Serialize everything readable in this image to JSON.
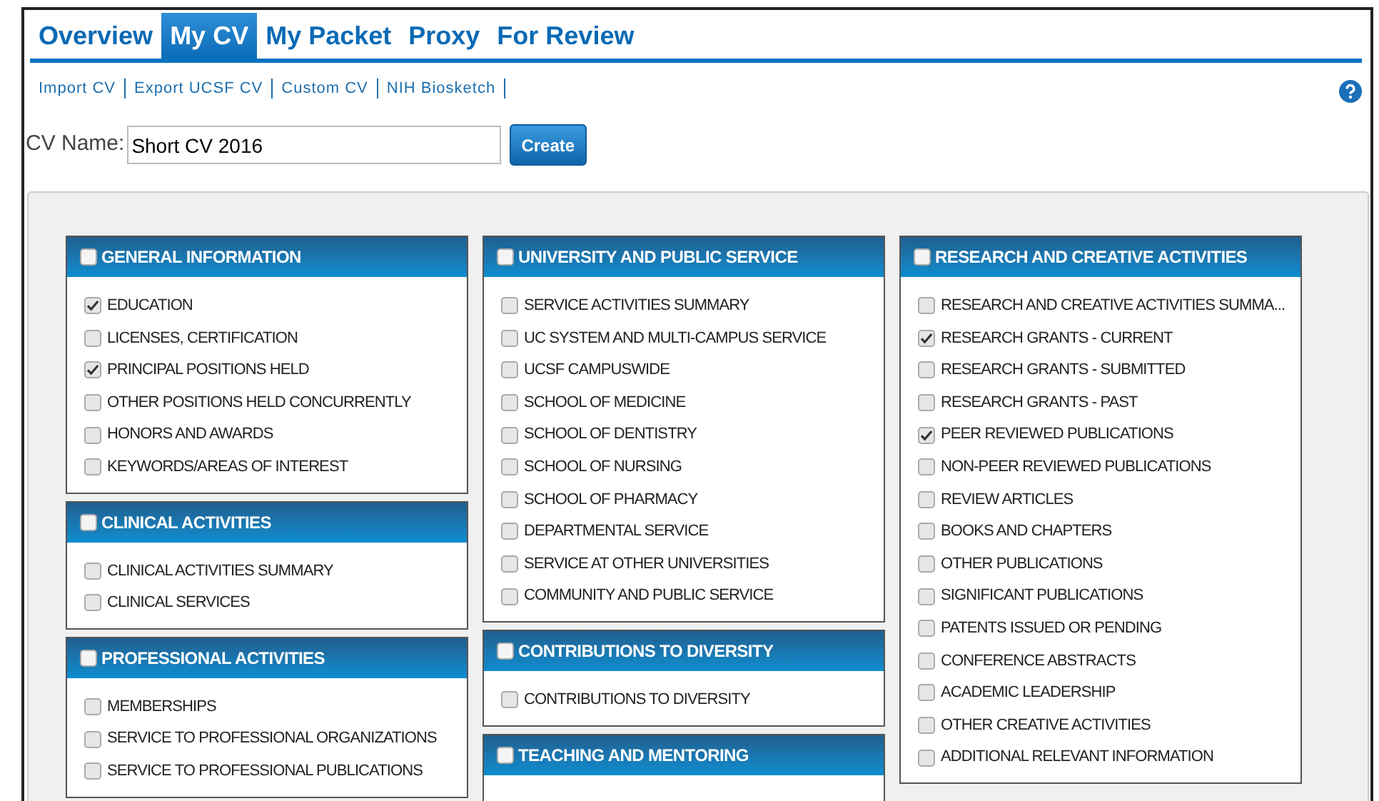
{
  "tabs": [
    {
      "label": "Overview",
      "selected": false
    },
    {
      "label": "My CV",
      "selected": true
    },
    {
      "label": "My Packet",
      "selected": false
    },
    {
      "label": "Proxy",
      "selected": false
    },
    {
      "label": "For Review",
      "selected": false
    }
  ],
  "sub_links": [
    "Import CV",
    "Export UCSF CV",
    "Custom CV",
    "NIH Biosketch"
  ],
  "cv_name": {
    "label": "CV Name:",
    "value": "Short CV 2016"
  },
  "create_button": "Create",
  "columns": [
    [
      {
        "title": "GENERAL INFORMATION",
        "checked": false,
        "items": [
          {
            "label": "EDUCATION",
            "checked": true
          },
          {
            "label": "LICENSES, CERTIFICATION",
            "checked": false
          },
          {
            "label": "PRINCIPAL POSITIONS HELD",
            "checked": true
          },
          {
            "label": "OTHER POSITIONS HELD CONCURRENTLY",
            "checked": false
          },
          {
            "label": "HONORS AND AWARDS",
            "checked": false
          },
          {
            "label": "KEYWORDS/AREAS OF INTEREST",
            "checked": false
          }
        ]
      },
      {
        "title": "CLINICAL ACTIVITIES",
        "checked": false,
        "items": [
          {
            "label": "CLINICAL ACTIVITIES SUMMARY",
            "checked": false
          },
          {
            "label": "CLINICAL SERVICES",
            "checked": false
          }
        ]
      },
      {
        "title": "PROFESSIONAL ACTIVITIES",
        "checked": false,
        "items": [
          {
            "label": "MEMBERSHIPS",
            "checked": false
          },
          {
            "label": "SERVICE TO PROFESSIONAL ORGANIZATIONS",
            "checked": false
          },
          {
            "label": "SERVICE TO PROFESSIONAL PUBLICATIONS",
            "checked": false
          }
        ]
      }
    ],
    [
      {
        "title": "UNIVERSITY AND PUBLIC SERVICE",
        "checked": false,
        "items": [
          {
            "label": "SERVICE ACTIVITIES SUMMARY",
            "checked": false
          },
          {
            "label": "UC SYSTEM AND MULTI-CAMPUS SERVICE",
            "checked": false
          },
          {
            "label": "UCSF CAMPUSWIDE",
            "checked": false
          },
          {
            "label": "SCHOOL OF MEDICINE",
            "checked": false
          },
          {
            "label": "SCHOOL OF DENTISTRY",
            "checked": false
          },
          {
            "label": "SCHOOL OF NURSING",
            "checked": false
          },
          {
            "label": "SCHOOL OF PHARMACY",
            "checked": false
          },
          {
            "label": "DEPARTMENTAL SERVICE",
            "checked": false
          },
          {
            "label": "SERVICE AT OTHER UNIVERSITIES",
            "checked": false
          },
          {
            "label": "COMMUNITY AND PUBLIC SERVICE",
            "checked": false
          }
        ]
      },
      {
        "title": "CONTRIBUTIONS TO DIVERSITY",
        "checked": false,
        "items": [
          {
            "label": "CONTRIBUTIONS TO DIVERSITY",
            "checked": false
          }
        ]
      },
      {
        "title": "TEACHING AND MENTORING",
        "checked": false
      }
    ],
    [
      {
        "title": "RESEARCH AND CREATIVE ACTIVITIES",
        "checked": false,
        "items": [
          {
            "label": "RESEARCH AND CREATIVE ACTIVITIES SUMMA...",
            "checked": false
          },
          {
            "label": "RESEARCH GRANTS - CURRENT",
            "checked": true
          },
          {
            "label": "RESEARCH GRANTS - SUBMITTED",
            "checked": false
          },
          {
            "label": "RESEARCH GRANTS - PAST",
            "checked": false
          },
          {
            "label": "PEER REVIEWED PUBLICATIONS",
            "checked": true
          },
          {
            "label": "NON-PEER REVIEWED PUBLICATIONS",
            "checked": false
          },
          {
            "label": "REVIEW ARTICLES",
            "checked": false
          },
          {
            "label": "BOOKS AND CHAPTERS",
            "checked": false
          },
          {
            "label": "OTHER PUBLICATIONS",
            "checked": false
          },
          {
            "label": "SIGNIFICANT PUBLICATIONS",
            "checked": false
          },
          {
            "label": "PATENTS ISSUED OR PENDING",
            "checked": false
          },
          {
            "label": "CONFERENCE ABSTRACTS",
            "checked": false
          },
          {
            "label": "ACADEMIC LEADERSHIP",
            "checked": false
          },
          {
            "label": "OTHER CREATIVE ACTIVITIES",
            "checked": false
          },
          {
            "label": "ADDITIONAL RELEVANT INFORMATION",
            "checked": false
          }
        ]
      }
    ]
  ]
}
